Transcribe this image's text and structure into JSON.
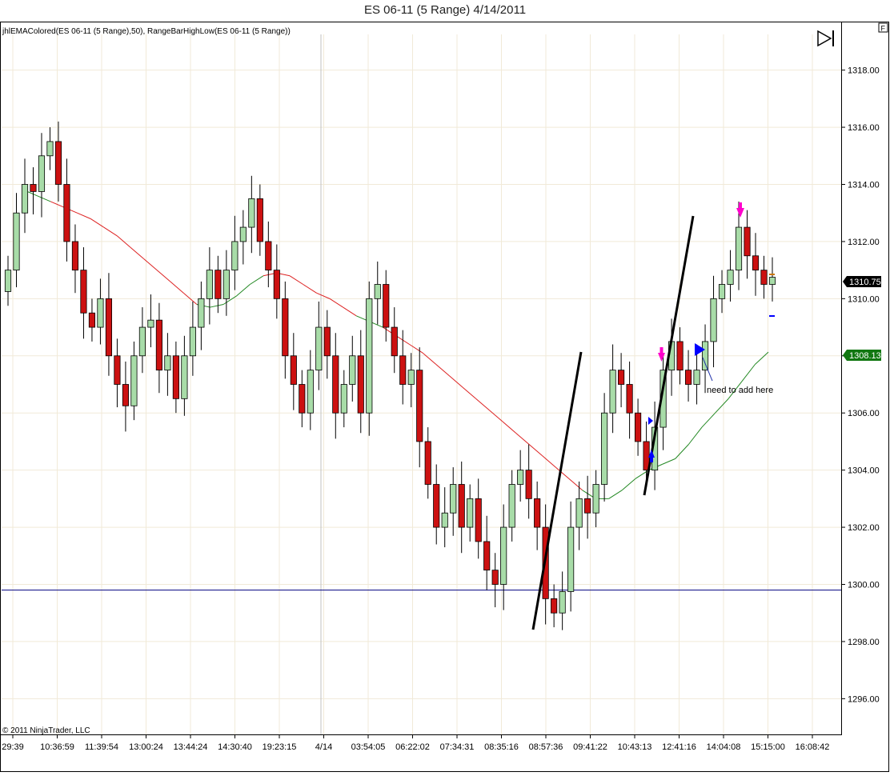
{
  "window": {
    "title": "ES 06-11 (5 Range)  4/14/2011"
  },
  "panel": {
    "indicator_label": "jhlEMAColored(ES 06-11 (5 Range),50), RangeBarHighLow(ES 06-11 (5 Range))",
    "copyright": "© 2011 NinjaTrader, LLC",
    "f_button": "F",
    "annotation_text": "need to add here"
  },
  "price_markers": {
    "last": "1310.75",
    "ema": "1308.13"
  },
  "colors": {
    "up_candle": "#a8dca8",
    "down_candle": "#cc1111",
    "ema_above": "#dd2222",
    "ema_below": "#228822",
    "horizontal_line": "#000080",
    "ema_tag": "#117711",
    "last_tag": "#000000",
    "marker_magenta": "#ff00cc",
    "marker_blue": "#0000ff"
  },
  "chart_data": {
    "type": "candlestick",
    "yaxis": {
      "ticks": [
        "1296.00",
        "1298.00",
        "1300.00",
        "1302.00",
        "1304.00",
        "1306.00",
        "1308.00",
        "1310.00",
        "1312.00",
        "1314.00",
        "1316.00",
        "1318.00"
      ],
      "ylim": [
        1294.75,
        1319.25
      ]
    },
    "xaxis": {
      "ticks": [
        "29:39",
        "10:36:59",
        "11:39:54",
        "13:00:24",
        "13:44:24",
        "14:30:40",
        "19:23:15",
        "4/14",
        "03:54:05",
        "06:22:02",
        "07:34:31",
        "08:35:16",
        "08:57:36",
        "09:41:22",
        "10:43:13",
        "12:41:16",
        "14:04:08",
        "15:15:00",
        "16:08:42"
      ]
    },
    "horizontal_line": 1299.8,
    "ema_last": 1308.13,
    "last_price": 1310.75,
    "closes": [
      1311,
      1313,
      1314,
      1313.75,
      1315,
      1315.5,
      1314,
      1312,
      1311,
      1309.5,
      1309,
      1310,
      1308,
      1307,
      1306.25,
      1308,
      1309,
      1309.25,
      1307.5,
      1308,
      1306.5,
      1308,
      1309,
      1310,
      1311,
      1310,
      1311,
      1312,
      1312.5,
      1313.5,
      1312,
      1311,
      1310,
      1308,
      1307,
      1306,
      1307.5,
      1309,
      1308,
      1306,
      1307,
      1308,
      1306,
      1310,
      1310.5,
      1309,
      1308,
      1307,
      1307.5,
      1305,
      1303.5,
      1302,
      1302.5,
      1303.5,
      1302,
      1303,
      1301.5,
      1300.5,
      1300,
      1302,
      1303.5,
      1304,
      1303,
      1302,
      1299.5,
      1299,
      1299.75,
      1302,
      1303,
      1302.5,
      1303.5,
      1306,
      1307.5,
      1307,
      1306,
      1305,
      1304,
      1305.5,
      1307.5,
      1308.5,
      1307.5,
      1307,
      1307.5,
      1308.5,
      1310,
      1310.5,
      1311,
      1312.5,
      1311.5,
      1311,
      1310.5,
      1310.75
    ],
    "ema": [
      1313.8,
      1313.6,
      1313.4,
      1313.2,
      1313,
      1312.8,
      1312.5,
      1312.2,
      1311.8,
      1311.4,
      1311,
      1310.6,
      1310.2,
      1309.8,
      1309.7,
      1309.8,
      1310.1,
      1310.5,
      1310.8,
      1310.9,
      1310.8,
      1310.5,
      1310.2,
      1310,
      1309.7,
      1309.4,
      1309.2,
      1309,
      1308.7,
      1308.4,
      1308.1,
      1307.7,
      1307.3,
      1306.9,
      1306.5,
      1306.1,
      1305.7,
      1305.3,
      1304.9,
      1304.5,
      1304.1,
      1303.7,
      1303.3,
      1303,
      1303,
      1303.3,
      1303.7,
      1304,
      1304.2,
      1304.4,
      1304.9,
      1305.5,
      1306,
      1306.5,
      1307.1,
      1307.7,
      1308.13
    ]
  }
}
